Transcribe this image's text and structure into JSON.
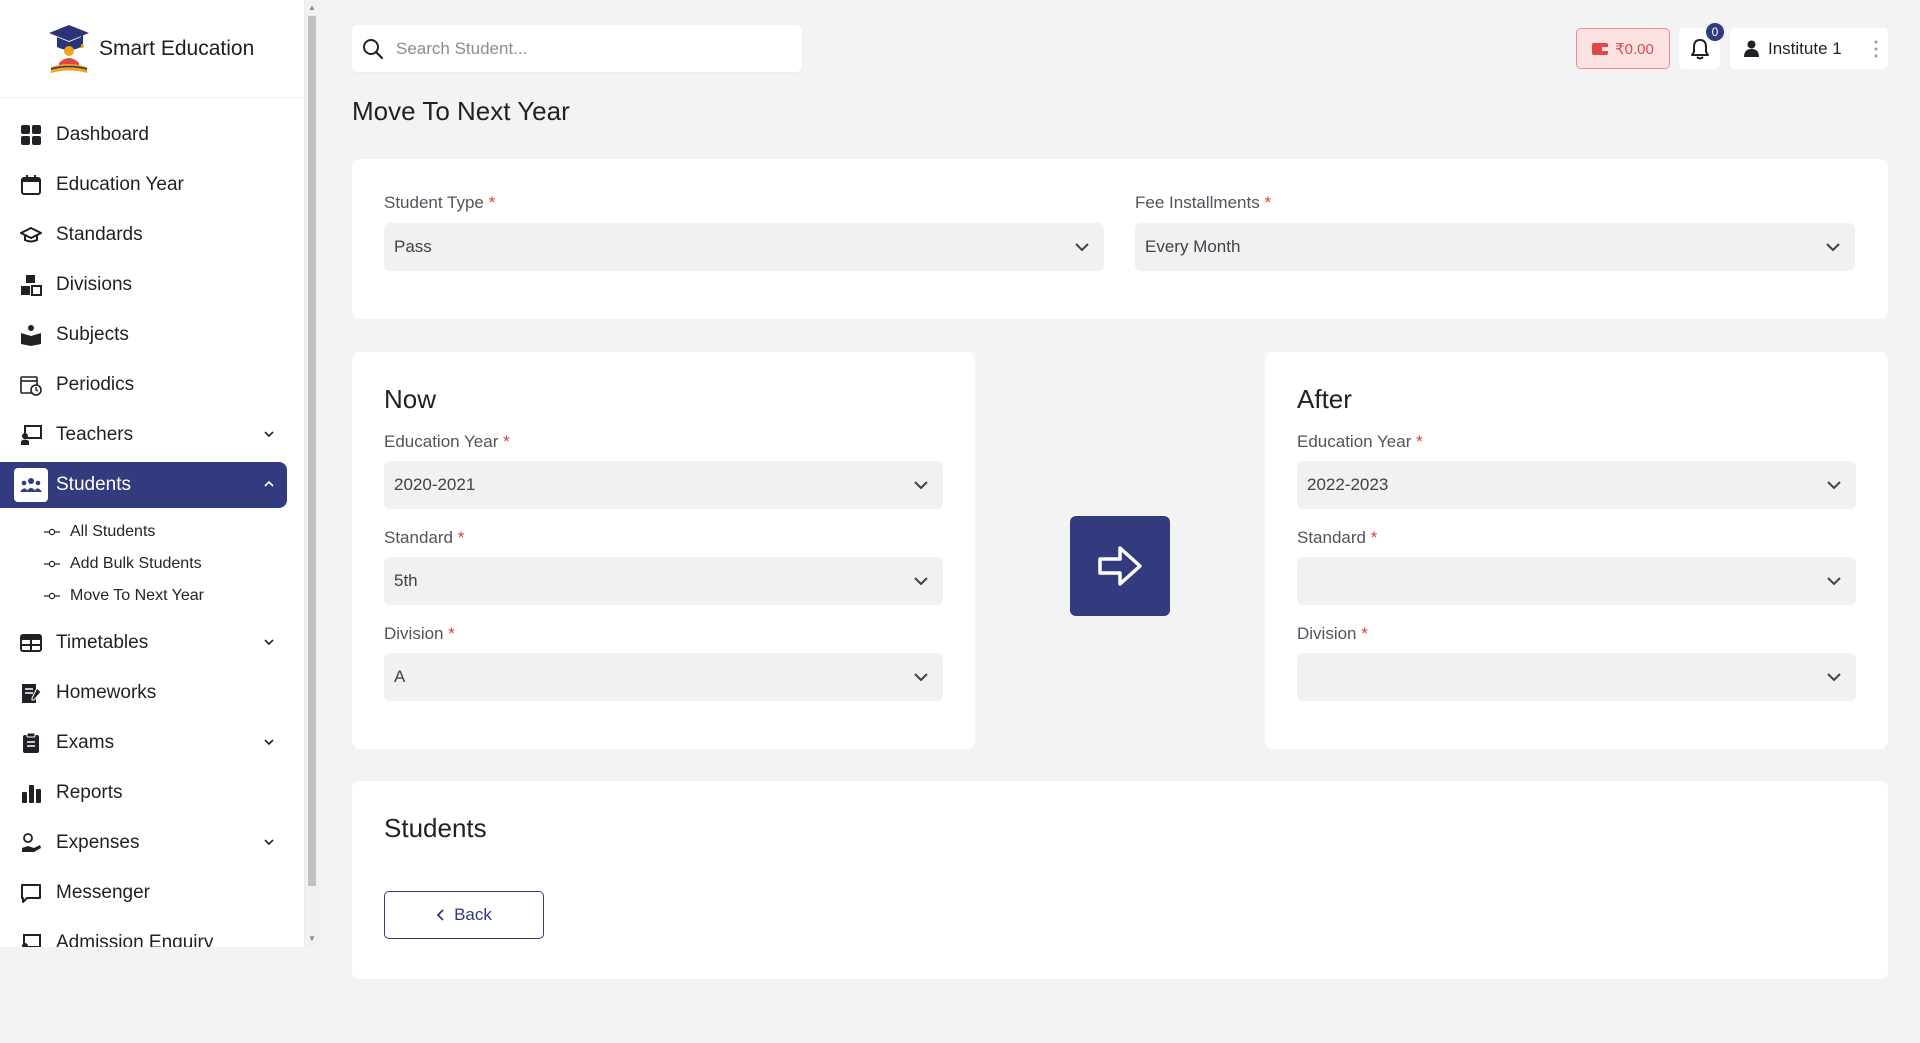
{
  "brand": {
    "name": "Smart Education"
  },
  "sidebar": {
    "items": [
      {
        "label": "Dashboard",
        "icon": "dashboard-icon"
      },
      {
        "label": "Education Year",
        "icon": "calendar-icon"
      },
      {
        "label": "Standards",
        "icon": "graduation-cap-icon"
      },
      {
        "label": "Divisions",
        "icon": "blocks-icon"
      },
      {
        "label": "Subjects",
        "icon": "book-reader-icon"
      },
      {
        "label": "Periodics",
        "icon": "calendar-clock-icon"
      },
      {
        "label": "Teachers",
        "icon": "chalkboard-teacher-icon",
        "expandable": true
      },
      {
        "label": "Students",
        "icon": "users-icon",
        "expandable": true,
        "active": true
      },
      {
        "label": "Timetables",
        "icon": "table-icon",
        "expandable": true
      },
      {
        "label": "Homeworks",
        "icon": "notebook-pen-icon"
      },
      {
        "label": "Exams",
        "icon": "clipboard-icon",
        "expandable": true
      },
      {
        "label": "Reports",
        "icon": "bar-chart-icon"
      },
      {
        "label": "Expenses",
        "icon": "hand-coin-icon",
        "expandable": true
      },
      {
        "label": "Messenger",
        "icon": "message-square-icon"
      },
      {
        "label": "Admission Enquiry",
        "icon": "chalkboard-icon"
      }
    ],
    "students_sub": [
      "All Students",
      "Add Bulk Students",
      "Move To Next Year"
    ]
  },
  "topbar": {
    "search_placeholder": "Search Student...",
    "wallet": "₹0.00",
    "notification_count": "0",
    "user": "Institute 1"
  },
  "page": {
    "title": "Move To Next Year"
  },
  "filters": {
    "student_type": {
      "label": "Student Type",
      "value": "Pass"
    },
    "fee_installments": {
      "label": "Fee Installments",
      "value": "Every Month"
    }
  },
  "now": {
    "title": "Now",
    "education_year": {
      "label": "Education Year",
      "value": "2020-2021"
    },
    "standard": {
      "label": "Standard",
      "value": "5th"
    },
    "division": {
      "label": "Division",
      "value": "A"
    }
  },
  "after": {
    "title": "After",
    "education_year": {
      "label": "Education Year",
      "value": "2022-2023"
    },
    "standard": {
      "label": "Standard",
      "value": ""
    },
    "division": {
      "label": "Division",
      "value": ""
    }
  },
  "students": {
    "title": "Students",
    "back_label": "Back"
  },
  "required_mark": "*",
  "colors": {
    "primary": "#323b7d",
    "danger": "#e04848",
    "background": "#f3f3f4"
  }
}
